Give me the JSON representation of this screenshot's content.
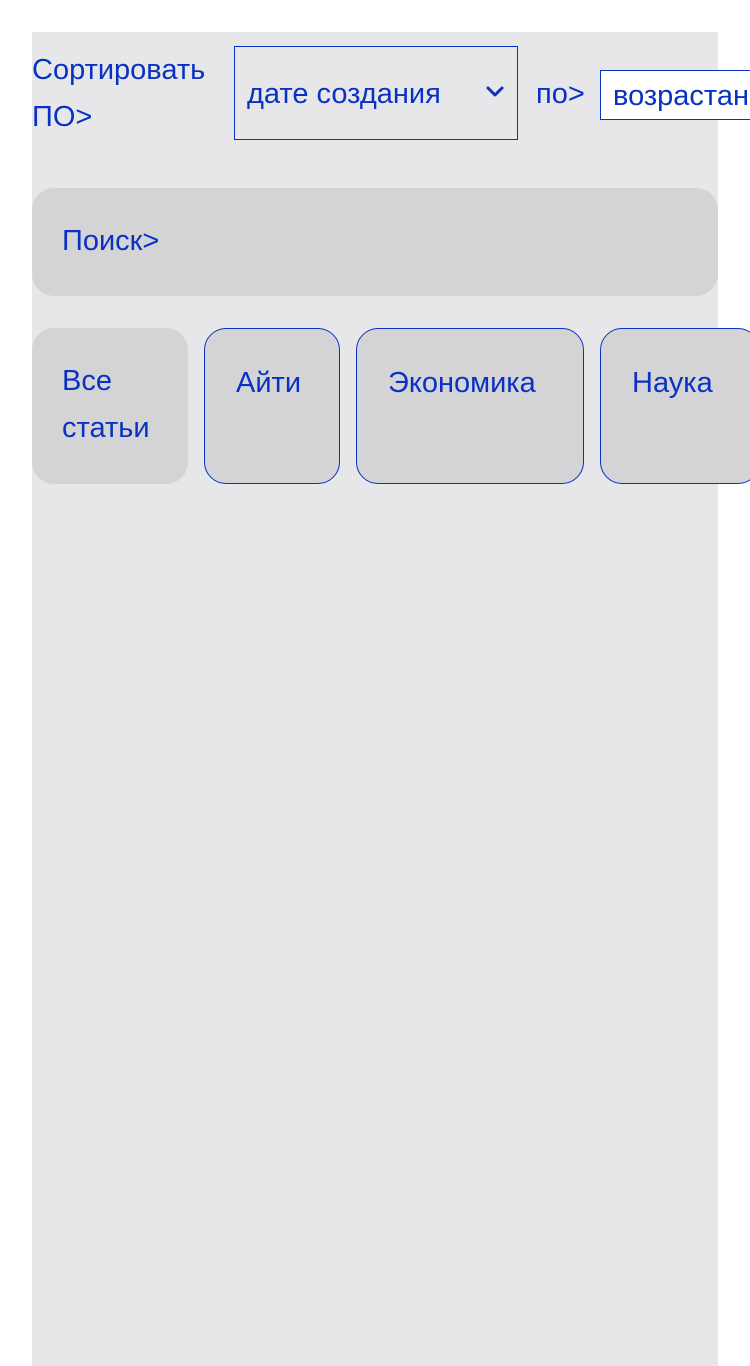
{
  "sort": {
    "label": "Сортировать ПО>",
    "field_selected": "дате создания",
    "order_label": "по>",
    "order_selected": "возрастанию"
  },
  "search": {
    "label": "Поиск>"
  },
  "tabs": [
    {
      "label": "Все статьи",
      "active": true
    },
    {
      "label": "Айти",
      "active": false
    },
    {
      "label": "Экономика",
      "active": false
    },
    {
      "label": "Наука",
      "active": false
    }
  ],
  "colors": {
    "accent": "#0a32c2",
    "panel_bg": "#e7e7ea",
    "control_bg": "#d4d4d7"
  },
  "icons": {
    "select_chevron": "chevron-down-icon"
  }
}
